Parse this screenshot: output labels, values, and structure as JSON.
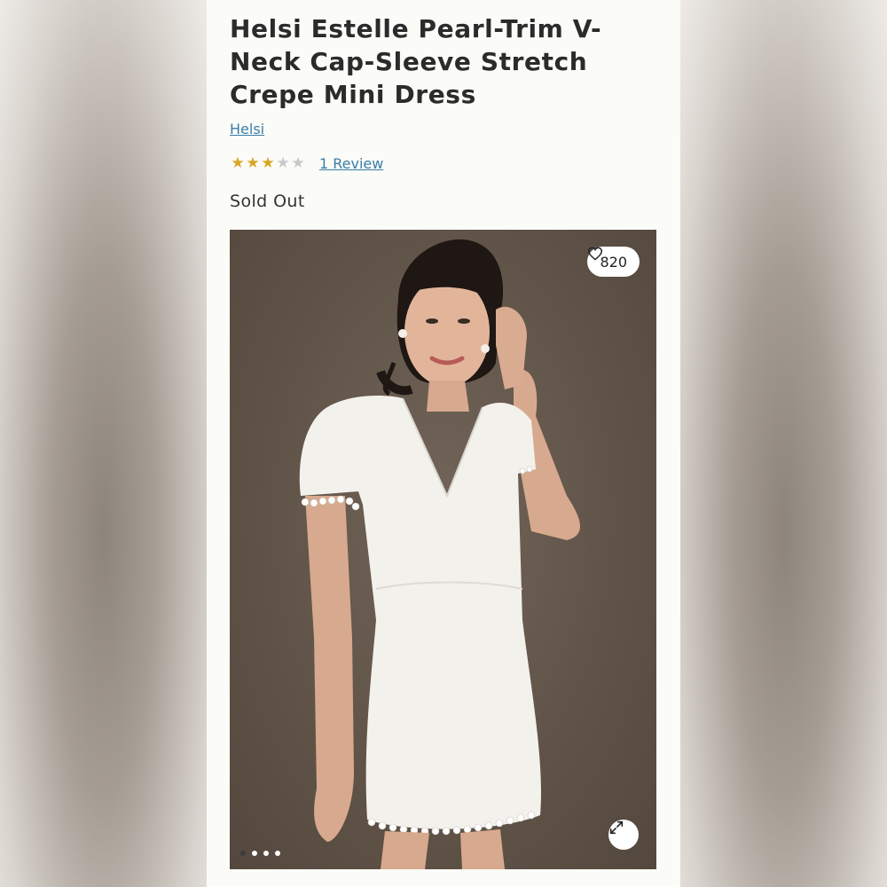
{
  "product": {
    "title": "Helsi Estelle Pearl-Trim V-Neck Cap-Sleeve Stretch Crepe Mini Dress",
    "brand": "Helsi",
    "rating": 3,
    "rating_max": 5,
    "review_link": "1 Review",
    "status": "Sold Out"
  },
  "gallery": {
    "likes": "820",
    "heart_icon": "heart-icon",
    "expand_icon": "expand-icon",
    "image_count": 4,
    "active_index": 0
  },
  "colors": {
    "star_filled": "#d8a623",
    "star_empty": "#c8c8c8",
    "link": "#3a7fa8"
  }
}
